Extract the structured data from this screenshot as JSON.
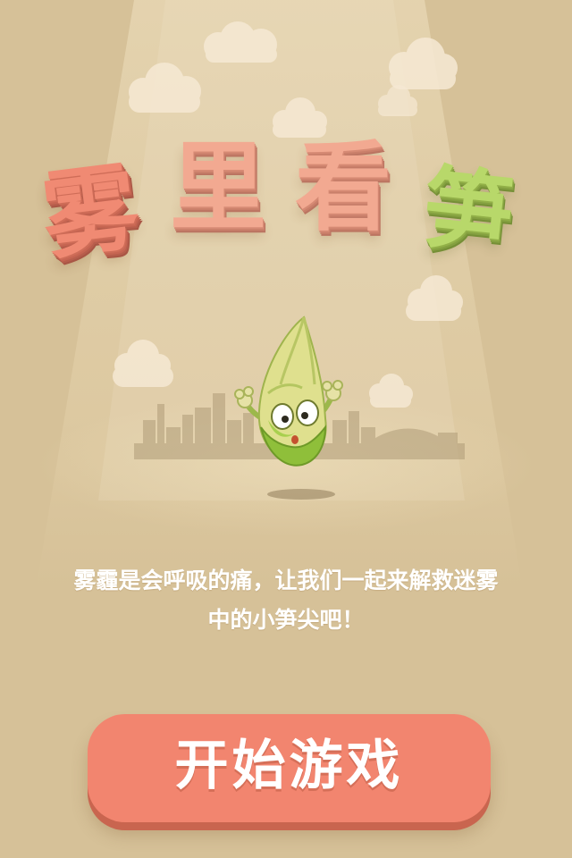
{
  "title": {
    "chars": [
      "雾",
      "里",
      "看",
      "笋"
    ]
  },
  "message": {
    "line1": "雾霾是会呼吸的痛，让我们一起来解救迷雾",
    "line2": "中的小笋尖吧！"
  },
  "start_button": {
    "label": "开始游戏"
  },
  "colors": {
    "background": "#d6c198",
    "title_pink": "#f2a991",
    "title_red": "#f08a73",
    "title_green": "#b8d86a",
    "button": "#f2856f",
    "button_text": "#ffffff",
    "message_text": "#ffffff"
  },
  "icons": {
    "mascot": "bamboo-shoot-character",
    "skyline": "city-skyline",
    "clouds": "cloud"
  }
}
